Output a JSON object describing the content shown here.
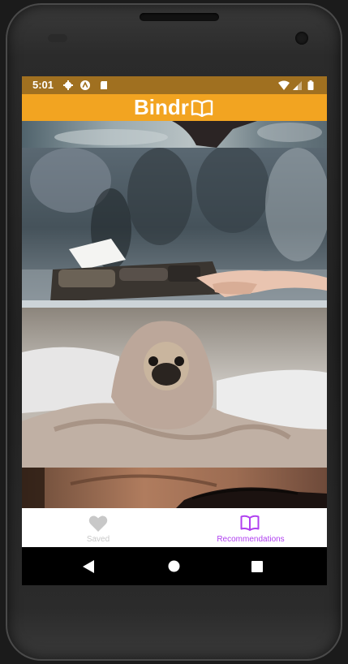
{
  "status_bar": {
    "time": "5:01",
    "icons_left": [
      "settings-icon",
      "app-a-icon",
      "sd-card-icon"
    ],
    "icons_right": [
      "wifi-icon",
      "signal-icon",
      "battery-icon"
    ],
    "background": "#a07020"
  },
  "app_bar": {
    "title": "Bindr",
    "logo_icon": "open-book-icon",
    "background": "#f2a421"
  },
  "feed": {
    "cards": [
      {
        "image": "smoky-hair-photo"
      },
      {
        "image": "typewriter-hands-photo"
      },
      {
        "image": "pug-in-blanket-photo"
      },
      {
        "image": "eye-closeup-photo"
      }
    ]
  },
  "bottom_nav": {
    "items": [
      {
        "label": "Saved",
        "icon": "heart-icon",
        "active": false,
        "color": "#c8c8c8"
      },
      {
        "label": "Recommendations",
        "icon": "open-book-icon",
        "active": true,
        "color": "#b040f0"
      }
    ]
  },
  "system_nav": {
    "keys": [
      "back-icon",
      "home-icon",
      "recents-icon"
    ]
  }
}
